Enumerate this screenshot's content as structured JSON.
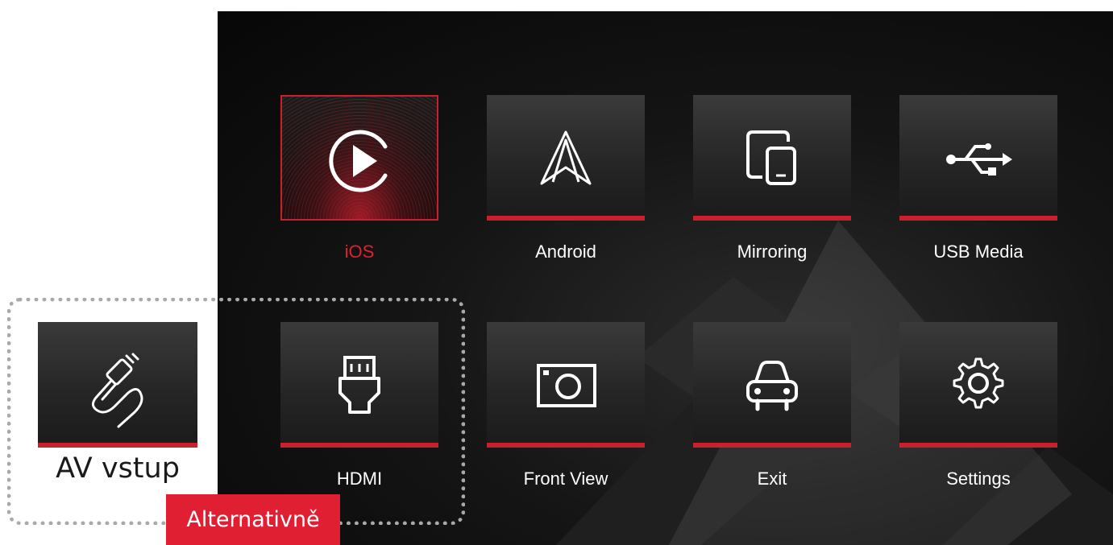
{
  "menu": {
    "items": [
      {
        "label": "iOS",
        "icon": "play-circle-icon",
        "selected": true
      },
      {
        "label": "Android",
        "icon": "android-auto-icon",
        "selected": false
      },
      {
        "label": "Mirroring",
        "icon": "mirroring-icon",
        "selected": false
      },
      {
        "label": "USB Media",
        "icon": "usb-icon",
        "selected": false
      },
      {
        "label": "HDMI",
        "icon": "hdmi-icon",
        "selected": false
      },
      {
        "label": "Front View",
        "icon": "camera-icon",
        "selected": false
      },
      {
        "label": "Exit",
        "icon": "car-icon",
        "selected": false
      },
      {
        "label": "Settings",
        "icon": "gear-icon",
        "selected": false
      }
    ]
  },
  "alternative": {
    "av_label": "AV vstup",
    "av_icon": "av-cable-icon",
    "badge": "Alternativně"
  },
  "colors": {
    "accent": "#c8202e",
    "active_label": "#e01f2f",
    "badge": "#e01f33"
  }
}
